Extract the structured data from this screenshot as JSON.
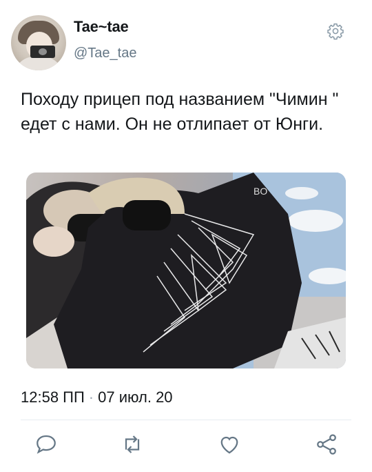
{
  "tweet": {
    "display_name": "Tae~tae",
    "handle": "@Tae_tae",
    "text": "Походу прицеп под названием \"Чимин \" едет с нами. Он не отлипает от Юнги.",
    "time": "12:58 ПП",
    "separator": "·",
    "date": "07 июл. 20"
  },
  "icons": {
    "settings": "gear-icon",
    "reply": "reply-icon",
    "retweet": "retweet-icon",
    "like": "heart-icon",
    "share": "share-icon"
  },
  "colors": {
    "text": "#14171a",
    "secondary": "#657786",
    "icon": "#657786",
    "divider": "#e6ecf0",
    "background": "#ffffff"
  }
}
